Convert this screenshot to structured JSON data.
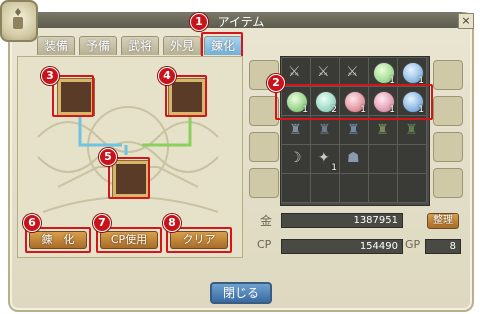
{
  "window": {
    "title": "アイテム",
    "close_label": "×"
  },
  "tabs": [
    {
      "label": "装備"
    },
    {
      "label": "予備"
    },
    {
      "label": "武将"
    },
    {
      "label": "外見"
    },
    {
      "label": "錬化",
      "active": true
    }
  ],
  "badges": [
    "1",
    "2",
    "3",
    "4",
    "5",
    "6",
    "7",
    "8"
  ],
  "left_panel": {
    "buttons": {
      "refine": "錬　化",
      "cp_use": "CP使用",
      "clear": "クリア"
    }
  },
  "inventory": {
    "row1": [
      {
        "icon": "sword-icon",
        "count": ""
      },
      {
        "icon": "sword-icon",
        "count": ""
      },
      {
        "icon": "sword-icon",
        "count": ""
      },
      {
        "icon": "orb-green-icon",
        "count": "1"
      },
      {
        "icon": "orb-blue-icon",
        "count": "1"
      }
    ],
    "row2": [
      {
        "icon": "orb-green-icon",
        "count": "1"
      },
      {
        "icon": "orb-teal-icon",
        "count": "2"
      },
      {
        "icon": "orb-red-icon",
        "count": "1"
      },
      {
        "icon": "orb-pink-icon",
        "count": "1"
      },
      {
        "icon": "orb-blue-icon",
        "count": "1"
      }
    ],
    "row3": [
      {
        "icon": "armor-icon",
        "count": ""
      },
      {
        "icon": "armor-icon",
        "count": ""
      },
      {
        "icon": "armor-icon",
        "count": ""
      },
      {
        "icon": "armor-icon",
        "count": ""
      },
      {
        "icon": "armor-icon",
        "count": ""
      }
    ],
    "row4": [
      {
        "icon": "blade-icon",
        "count": ""
      },
      {
        "icon": "shuriken-icon",
        "count": "1"
      },
      {
        "icon": "helmet-icon",
        "count": ""
      },
      {
        "icon": "",
        "count": ""
      },
      {
        "icon": "",
        "count": ""
      }
    ],
    "row5": [
      {
        "icon": "",
        "count": ""
      },
      {
        "icon": "",
        "count": ""
      },
      {
        "icon": "",
        "count": ""
      },
      {
        "icon": "",
        "count": ""
      },
      {
        "icon": "",
        "count": ""
      }
    ]
  },
  "money": {
    "gold_label": "金",
    "gold_value": "1387951",
    "sort_button": "整理",
    "cp_label": "CP",
    "cp_value": "154490",
    "gp_label": "GP",
    "gp_value": "8"
  },
  "footer": {
    "close_button": "閉じる"
  },
  "colors": {
    "highlight": "#d3161a",
    "active_tab": "#6fb2db"
  }
}
